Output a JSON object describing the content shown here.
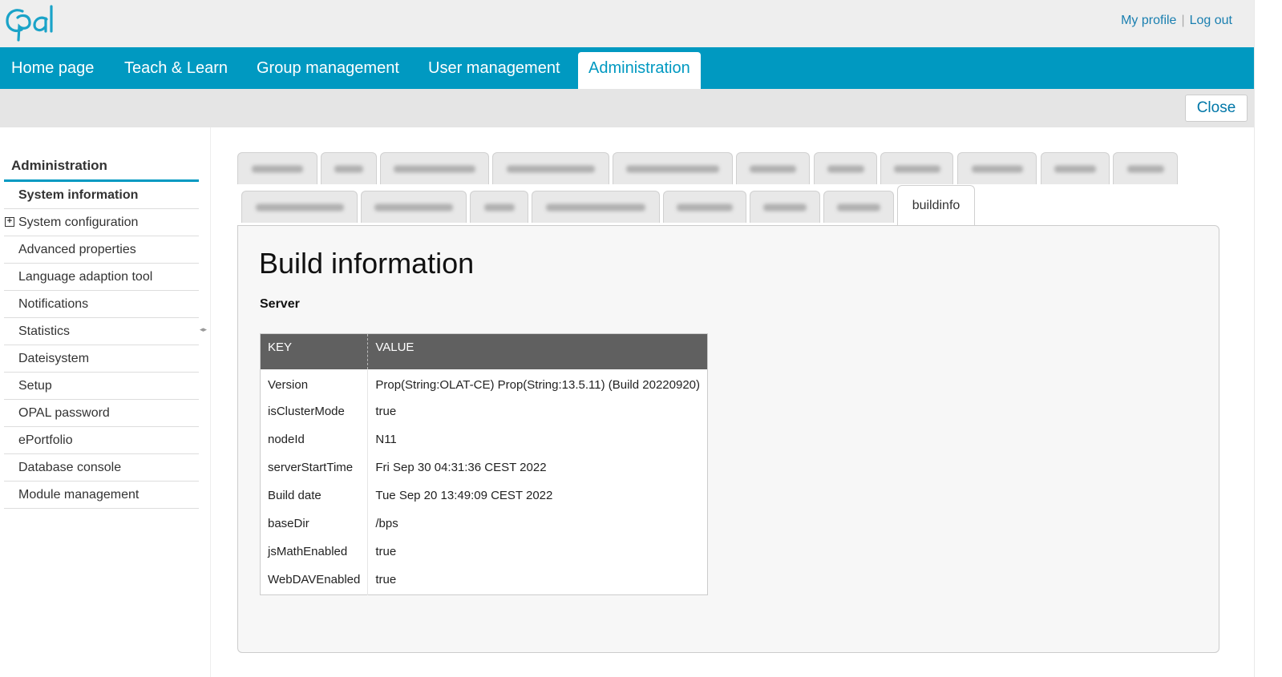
{
  "header": {
    "logo_text": "Opal",
    "my_profile": "My profile",
    "separator": "|",
    "log_out": "Log out"
  },
  "nav": {
    "items": [
      {
        "label": "Home page"
      },
      {
        "label": "Teach & Learn"
      },
      {
        "label": "Group management"
      },
      {
        "label": "User management"
      },
      {
        "label": "Administration",
        "active": true
      }
    ]
  },
  "toolbar": {
    "close_label": "Close"
  },
  "sidebar": {
    "title": "Administration",
    "items": [
      {
        "label": "System information",
        "active": true
      },
      {
        "label": "System configuration",
        "expandable": true
      },
      {
        "label": "Advanced properties"
      },
      {
        "label": "Language adaption tool"
      },
      {
        "label": "Notifications"
      },
      {
        "label": "Statistics"
      },
      {
        "label": "Dateisystem"
      },
      {
        "label": "Setup"
      },
      {
        "label": "OPAL password"
      },
      {
        "label": "ePortfolio"
      },
      {
        "label": "Database console"
      },
      {
        "label": "Module management"
      }
    ]
  },
  "tabs": {
    "active_label": "buildinfo"
  },
  "main": {
    "title": "Build information",
    "subtitle": "Server",
    "table": {
      "headers": [
        "KEY",
        "VALUE"
      ],
      "rows": [
        [
          "Version",
          "Prop(String:OLAT-CE) Prop(String:13.5.11) (Build 20220920)"
        ],
        [
          "isClusterMode",
          "true"
        ],
        [
          "nodeId",
          "N11"
        ],
        [
          "serverStartTime",
          "Fri Sep 30 04:31:36 CEST 2022"
        ],
        [
          "Build date",
          "Tue Sep 20 13:49:09 CEST 2022"
        ],
        [
          "baseDir",
          "/bps"
        ],
        [
          "jsMathEnabled",
          "true"
        ],
        [
          "WebDAVEnabled",
          "true"
        ]
      ]
    }
  },
  "colors": {
    "brand": "#0099c1",
    "header_bg": "#eeeeee",
    "table_header_bg": "#606060"
  }
}
